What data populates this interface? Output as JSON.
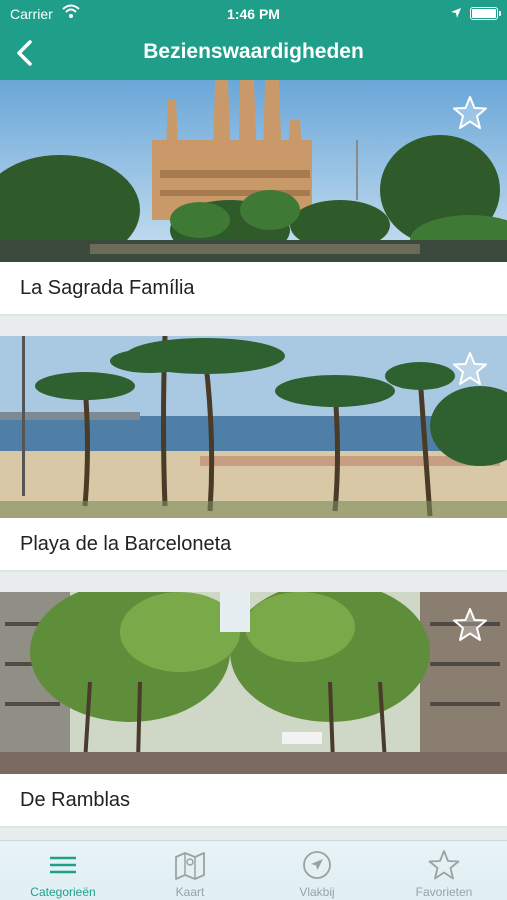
{
  "status": {
    "carrier": "Carrier",
    "time": "1:46 PM"
  },
  "nav": {
    "title": "Bezienswaardigheden"
  },
  "items": [
    {
      "name": "La Sagrada Família"
    },
    {
      "name": "Playa de la Barceloneta"
    },
    {
      "name": "De Ramblas"
    }
  ],
  "tabs": [
    {
      "label": "Categorieën",
      "icon": "menu-icon",
      "active": true
    },
    {
      "label": "Kaart",
      "icon": "map-icon",
      "active": false
    },
    {
      "label": "Vlakbij",
      "icon": "navigation-icon",
      "active": false
    },
    {
      "label": "Favorieten",
      "icon": "star-icon",
      "active": false
    }
  ],
  "colors": {
    "brand": "#1f9f8a",
    "tab_inactive": "#9aa2a4"
  }
}
